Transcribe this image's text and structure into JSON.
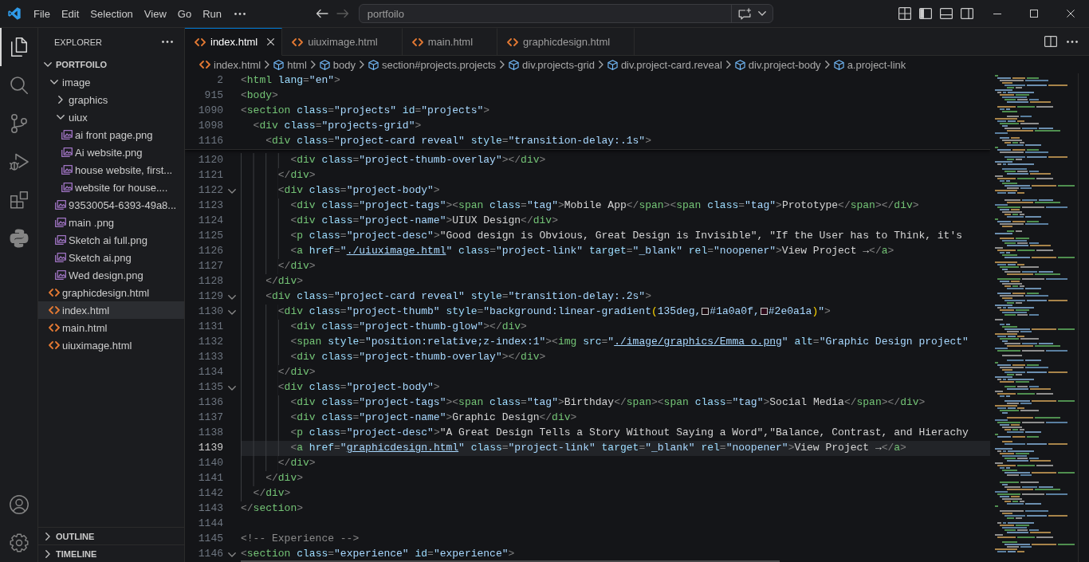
{
  "title_bar": {
    "menu": [
      "File",
      "Edit",
      "Selection",
      "View",
      "Go",
      "Run"
    ],
    "nav_buttons": [
      {
        "kind": "back",
        "disabled": false
      },
      {
        "kind": "forward",
        "disabled": true
      }
    ],
    "command_center": {
      "label": "portfoilo"
    },
    "layout_toggles": [
      {
        "kind": "primary_sidebar",
        "on": true
      },
      {
        "kind": "panel",
        "on": false
      },
      {
        "kind": "secondary_sidebar",
        "on": false
      }
    ]
  },
  "activity_bar": {
    "items": [
      {
        "kind": "explorer",
        "selected": true
      },
      {
        "kind": "search",
        "selected": false
      },
      {
        "kind": "source_control",
        "selected": false
      },
      {
        "kind": "run_debug",
        "selected": false
      },
      {
        "kind": "extensions",
        "selected": false
      },
      {
        "kind": "python",
        "selected": false
      }
    ],
    "bottom_items": [
      {
        "kind": "accounts"
      },
      {
        "kind": "settings"
      }
    ]
  },
  "explorer": {
    "title": "EXPLORER",
    "folder": {
      "label": "PORTFOILO",
      "expanded": true
    },
    "tree": [
      {
        "label": "image",
        "kind": "folder",
        "expanded": true,
        "selected": false,
        "children": [
          {
            "label": "graphics",
            "kind": "folder",
            "expanded": false,
            "selected": false
          },
          {
            "label": "uiux",
            "kind": "folder",
            "expanded": true,
            "selected": false,
            "children": [
              {
                "label": "ai front page.png",
                "kind": "image",
                "selected": false
              },
              {
                "label": "Ai website.png",
                "kind": "image",
                "selected": false
              },
              {
                "label": "house website, first...",
                "kind": "image",
                "selected": false
              },
              {
                "label": "website for house....",
                "kind": "image",
                "selected": false
              }
            ]
          },
          {
            "label": "93530054-6393-49a8...",
            "kind": "image",
            "selected": false
          },
          {
            "label": "main .png",
            "kind": "image",
            "selected": false
          },
          {
            "label": "Sketch ai full.png",
            "kind": "image",
            "selected": false
          },
          {
            "label": "Sketch ai.png",
            "kind": "image",
            "selected": false
          },
          {
            "label": "Wed design.png",
            "kind": "image",
            "selected": false
          }
        ]
      },
      {
        "label": "graphicdesign.html",
        "kind": "html",
        "selected": false
      },
      {
        "label": "index.html",
        "kind": "html",
        "selected": true
      },
      {
        "label": "main.html",
        "kind": "html",
        "selected": false
      },
      {
        "label": "uiuximage.html",
        "kind": "html",
        "selected": false
      }
    ],
    "sections": [
      {
        "label": "OUTLINE",
        "expanded": false
      },
      {
        "label": "TIMELINE",
        "expanded": false
      }
    ]
  },
  "tabs": [
    {
      "label": "index.html",
      "selected": true
    },
    {
      "label": "uiuximage.html",
      "selected": false
    },
    {
      "label": "main.html",
      "selected": false
    },
    {
      "label": "graphicdesign.html",
      "selected": false
    }
  ],
  "breadcrumbs": [
    {
      "label": "index.html",
      "kind": "file"
    },
    {
      "label": "html",
      "kind": "element"
    },
    {
      "label": "body",
      "kind": "element"
    },
    {
      "label": "section#projects.projects",
      "kind": "element"
    },
    {
      "label": "div.projects-grid",
      "kind": "element"
    },
    {
      "label": "div.project-card.reveal",
      "kind": "element"
    },
    {
      "label": "div.project-body",
      "kind": "element"
    },
    {
      "label": "a.project-link",
      "kind": "element"
    }
  ],
  "editor": {
    "sticky_lines": [
      {
        "number": "2",
        "tokens": [
          {
            "kind": "punct",
            "text": "<"
          },
          {
            "kind": "tag",
            "text": "html"
          },
          {
            "kind": "attr",
            "text": " lang"
          },
          {
            "kind": "punct",
            "text": "="
          },
          {
            "kind": "string",
            "text": "\"en\""
          },
          {
            "kind": "punct",
            "text": ">"
          }
        ]
      },
      {
        "number": "915",
        "tokens": [
          {
            "kind": "punct",
            "text": "<"
          },
          {
            "kind": "tag",
            "text": "body"
          },
          {
            "kind": "punct",
            "text": ">"
          }
        ]
      },
      {
        "number": "1090",
        "tokens": [
          {
            "kind": "punct",
            "text": "<"
          },
          {
            "kind": "tag",
            "text": "section"
          },
          {
            "kind": "attr",
            "text": " class"
          },
          {
            "kind": "punct",
            "text": "="
          },
          {
            "kind": "string",
            "text": "\"projects\""
          },
          {
            "kind": "attr",
            "text": " id"
          },
          {
            "kind": "punct",
            "text": "="
          },
          {
            "kind": "string",
            "text": "\"projects\""
          },
          {
            "kind": "punct",
            "text": ">"
          }
        ]
      },
      {
        "number": "1098",
        "tokens": [
          {
            "kind": "punct",
            "text": "  <"
          },
          {
            "kind": "tag",
            "text": "div"
          },
          {
            "kind": "attr",
            "text": " class"
          },
          {
            "kind": "punct",
            "text": "="
          },
          {
            "kind": "string",
            "text": "\"projects-grid\""
          },
          {
            "kind": "punct",
            "text": ">"
          }
        ]
      },
      {
        "number": "1116",
        "tokens": [
          {
            "kind": "punct",
            "text": "    <"
          },
          {
            "kind": "tag",
            "text": "div"
          },
          {
            "kind": "attr",
            "text": " class"
          },
          {
            "kind": "punct",
            "text": "="
          },
          {
            "kind": "string",
            "text": "\"project-card reveal\""
          },
          {
            "kind": "attr",
            "text": " style"
          },
          {
            "kind": "punct",
            "text": "="
          },
          {
            "kind": "string",
            "text": "\"transition-delay:.1s\""
          },
          {
            "kind": "punct",
            "text": ">"
          }
        ]
      }
    ],
    "lines": [
      {
        "number": "1120",
        "fold_marker": false,
        "current": false,
        "tokens": [
          {
            "kind": "punct",
            "text": "        <"
          },
          {
            "kind": "tag",
            "text": "div"
          },
          {
            "kind": "attr",
            "text": " class"
          },
          {
            "kind": "punct",
            "text": "="
          },
          {
            "kind": "string",
            "text": "\"project-thumb-overlay\""
          },
          {
            "kind": "punct",
            "text": "></"
          },
          {
            "kind": "tag",
            "text": "div"
          },
          {
            "kind": "punct",
            "text": ">"
          }
        ]
      },
      {
        "number": "1121",
        "fold_marker": false,
        "current": false,
        "tokens": [
          {
            "kind": "punct",
            "text": "      </"
          },
          {
            "kind": "tag",
            "text": "div"
          },
          {
            "kind": "punct",
            "text": ">"
          }
        ]
      },
      {
        "number": "1122",
        "fold_marker": true,
        "current": false,
        "tokens": [
          {
            "kind": "punct",
            "text": "      <"
          },
          {
            "kind": "tag",
            "text": "div"
          },
          {
            "kind": "attr",
            "text": " class"
          },
          {
            "kind": "punct",
            "text": "="
          },
          {
            "kind": "string",
            "text": "\"project-body\""
          },
          {
            "kind": "punct",
            "text": ">"
          }
        ]
      },
      {
        "number": "1123",
        "fold_marker": false,
        "current": false,
        "tokens": [
          {
            "kind": "punct",
            "text": "        <"
          },
          {
            "kind": "tag",
            "text": "div"
          },
          {
            "kind": "attr",
            "text": " class"
          },
          {
            "kind": "punct",
            "text": "="
          },
          {
            "kind": "string",
            "text": "\"project-tags\""
          },
          {
            "kind": "punct",
            "text": "><"
          },
          {
            "kind": "tag",
            "text": "span"
          },
          {
            "kind": "attr",
            "text": " class"
          },
          {
            "kind": "punct",
            "text": "="
          },
          {
            "kind": "string",
            "text": "\"tag\""
          },
          {
            "kind": "punct",
            "text": ">"
          },
          {
            "kind": "text",
            "text": "Mobile App"
          },
          {
            "kind": "punct",
            "text": "</"
          },
          {
            "kind": "tag",
            "text": "span"
          },
          {
            "kind": "punct",
            "text": "><"
          },
          {
            "kind": "tag",
            "text": "span"
          },
          {
            "kind": "attr",
            "text": " class"
          },
          {
            "kind": "punct",
            "text": "="
          },
          {
            "kind": "string",
            "text": "\"tag\""
          },
          {
            "kind": "punct",
            "text": ">"
          },
          {
            "kind": "text",
            "text": "Prototype"
          },
          {
            "kind": "punct",
            "text": "</"
          },
          {
            "kind": "tag",
            "text": "span"
          },
          {
            "kind": "punct",
            "text": "></"
          },
          {
            "kind": "tag",
            "text": "div"
          },
          {
            "kind": "punct",
            "text": ">"
          }
        ]
      },
      {
        "number": "1124",
        "fold_marker": false,
        "current": false,
        "tokens": [
          {
            "kind": "punct",
            "text": "        <"
          },
          {
            "kind": "tag",
            "text": "div"
          },
          {
            "kind": "attr",
            "text": " class"
          },
          {
            "kind": "punct",
            "text": "="
          },
          {
            "kind": "string",
            "text": "\"project-name\""
          },
          {
            "kind": "punct",
            "text": ">"
          },
          {
            "kind": "text",
            "text": "UIUX Design"
          },
          {
            "kind": "punct",
            "text": "</"
          },
          {
            "kind": "tag",
            "text": "div"
          },
          {
            "kind": "punct",
            "text": ">"
          }
        ]
      },
      {
        "number": "1125",
        "fold_marker": false,
        "current": false,
        "tokens": [
          {
            "kind": "punct",
            "text": "        <"
          },
          {
            "kind": "tag",
            "text": "p"
          },
          {
            "kind": "attr",
            "text": " class"
          },
          {
            "kind": "punct",
            "text": "="
          },
          {
            "kind": "string",
            "text": "\"project-desc\""
          },
          {
            "kind": "punct",
            "text": ">"
          },
          {
            "kind": "text",
            "text": "\"Good design is Obvious, Great Design is Invisible\", \"If the User has to Think, it's"
          }
        ]
      },
      {
        "number": "1126",
        "fold_marker": false,
        "current": false,
        "tokens": [
          {
            "kind": "punct",
            "text": "        <"
          },
          {
            "kind": "tag",
            "text": "a"
          },
          {
            "kind": "attr",
            "text": " href"
          },
          {
            "kind": "punct",
            "text": "="
          },
          {
            "kind": "string",
            "text": "\""
          },
          {
            "kind": "link",
            "text": "./uiuximage.html"
          },
          {
            "kind": "string",
            "text": "\""
          },
          {
            "kind": "attr",
            "text": " class"
          },
          {
            "kind": "punct",
            "text": "="
          },
          {
            "kind": "string",
            "text": "\"project-link\""
          },
          {
            "kind": "attr",
            "text": " target"
          },
          {
            "kind": "punct",
            "text": "="
          },
          {
            "kind": "string",
            "text": "\"_blank\""
          },
          {
            "kind": "attr",
            "text": " rel"
          },
          {
            "kind": "punct",
            "text": "="
          },
          {
            "kind": "string",
            "text": "\"noopener\""
          },
          {
            "kind": "punct",
            "text": ">"
          },
          {
            "kind": "text",
            "text": "View Project →"
          },
          {
            "kind": "punct",
            "text": "</"
          },
          {
            "kind": "tag",
            "text": "a"
          },
          {
            "kind": "punct",
            "text": ">"
          }
        ]
      },
      {
        "number": "1127",
        "fold_marker": false,
        "current": false,
        "tokens": [
          {
            "kind": "punct",
            "text": "      </"
          },
          {
            "kind": "tag",
            "text": "div"
          },
          {
            "kind": "punct",
            "text": ">"
          }
        ]
      },
      {
        "number": "1128",
        "fold_marker": false,
        "current": false,
        "tokens": [
          {
            "kind": "punct",
            "text": "    </"
          },
          {
            "kind": "tag",
            "text": "div"
          },
          {
            "kind": "punct",
            "text": ">"
          }
        ]
      },
      {
        "number": "1129",
        "fold_marker": true,
        "current": false,
        "tokens": [
          {
            "kind": "punct",
            "text": "    <"
          },
          {
            "kind": "tag",
            "text": "div"
          },
          {
            "kind": "attr",
            "text": " class"
          },
          {
            "kind": "punct",
            "text": "="
          },
          {
            "kind": "string",
            "text": "\"project-card reveal\""
          },
          {
            "kind": "attr",
            "text": " style"
          },
          {
            "kind": "punct",
            "text": "="
          },
          {
            "kind": "string",
            "text": "\"transition-delay:.2s\""
          },
          {
            "kind": "punct",
            "text": ">"
          }
        ]
      },
      {
        "number": "1130",
        "fold_marker": true,
        "current": false,
        "tokens": [
          {
            "kind": "punct",
            "text": "      <"
          },
          {
            "kind": "tag",
            "text": "div"
          },
          {
            "kind": "attr",
            "text": " class"
          },
          {
            "kind": "punct",
            "text": "="
          },
          {
            "kind": "string",
            "text": "\"project-thumb\""
          },
          {
            "kind": "attr",
            "text": " style"
          },
          {
            "kind": "punct",
            "text": "="
          },
          {
            "kind": "string",
            "text": "\"background:linear-gradient"
          },
          {
            "kind": "bracket",
            "text": "("
          },
          {
            "kind": "string",
            "text": "135deg,"
          },
          {
            "kind": "swatch",
            "color": "#1a0a0f"
          },
          {
            "kind": "string",
            "text": "#1a0a0f,"
          },
          {
            "kind": "swatch",
            "color": "#2e0a1a"
          },
          {
            "kind": "string",
            "text": "#2e0a1a"
          },
          {
            "kind": "bracket",
            "text": ")"
          },
          {
            "kind": "string",
            "text": "\""
          },
          {
            "kind": "punct",
            "text": ">"
          }
        ]
      },
      {
        "number": "1131",
        "fold_marker": false,
        "current": false,
        "tokens": [
          {
            "kind": "punct",
            "text": "        <"
          },
          {
            "kind": "tag",
            "text": "div"
          },
          {
            "kind": "attr",
            "text": " class"
          },
          {
            "kind": "punct",
            "text": "="
          },
          {
            "kind": "string",
            "text": "\"project-thumb-glow\""
          },
          {
            "kind": "punct",
            "text": "></"
          },
          {
            "kind": "tag",
            "text": "div"
          },
          {
            "kind": "punct",
            "text": ">"
          }
        ]
      },
      {
        "number": "1132",
        "fold_marker": false,
        "current": false,
        "tokens": [
          {
            "kind": "punct",
            "text": "        <"
          },
          {
            "kind": "tag",
            "text": "span"
          },
          {
            "kind": "attr",
            "text": " style"
          },
          {
            "kind": "punct",
            "text": "="
          },
          {
            "kind": "string",
            "text": "\"position:relative;z-index:1\""
          },
          {
            "kind": "punct",
            "text": "><"
          },
          {
            "kind": "tag",
            "text": "img"
          },
          {
            "kind": "attr",
            "text": " src"
          },
          {
            "kind": "punct",
            "text": "="
          },
          {
            "kind": "string",
            "text": "\""
          },
          {
            "kind": "link",
            "text": "./image/graphics/Emma_o.png"
          },
          {
            "kind": "string",
            "text": "\""
          },
          {
            "kind": "attr",
            "text": " alt"
          },
          {
            "kind": "punct",
            "text": "="
          },
          {
            "kind": "string",
            "text": "\"Graphic Design project\""
          }
        ]
      },
      {
        "number": "1133",
        "fold_marker": false,
        "current": false,
        "tokens": [
          {
            "kind": "punct",
            "text": "        <"
          },
          {
            "kind": "tag",
            "text": "div"
          },
          {
            "kind": "attr",
            "text": " class"
          },
          {
            "kind": "punct",
            "text": "="
          },
          {
            "kind": "string",
            "text": "\"project-thumb-overlay\""
          },
          {
            "kind": "punct",
            "text": "></"
          },
          {
            "kind": "tag",
            "text": "div"
          },
          {
            "kind": "punct",
            "text": ">"
          }
        ]
      },
      {
        "number": "1134",
        "fold_marker": false,
        "current": false,
        "tokens": [
          {
            "kind": "punct",
            "text": "      </"
          },
          {
            "kind": "tag",
            "text": "div"
          },
          {
            "kind": "punct",
            "text": ">"
          }
        ]
      },
      {
        "number": "1135",
        "fold_marker": true,
        "current": false,
        "tokens": [
          {
            "kind": "punct",
            "text": "      <"
          },
          {
            "kind": "tag",
            "text": "div"
          },
          {
            "kind": "attr",
            "text": " class"
          },
          {
            "kind": "punct",
            "text": "="
          },
          {
            "kind": "string",
            "text": "\"project-body\""
          },
          {
            "kind": "punct",
            "text": ">"
          }
        ]
      },
      {
        "number": "1136",
        "fold_marker": false,
        "current": false,
        "tokens": [
          {
            "kind": "punct",
            "text": "        <"
          },
          {
            "kind": "tag",
            "text": "div"
          },
          {
            "kind": "attr",
            "text": " class"
          },
          {
            "kind": "punct",
            "text": "="
          },
          {
            "kind": "string",
            "text": "\"project-tags\""
          },
          {
            "kind": "punct",
            "text": "><"
          },
          {
            "kind": "tag",
            "text": "span"
          },
          {
            "kind": "attr",
            "text": " class"
          },
          {
            "kind": "punct",
            "text": "="
          },
          {
            "kind": "string",
            "text": "\"tag\""
          },
          {
            "kind": "punct",
            "text": ">"
          },
          {
            "kind": "text",
            "text": "Birthday"
          },
          {
            "kind": "punct",
            "text": "</"
          },
          {
            "kind": "tag",
            "text": "span"
          },
          {
            "kind": "punct",
            "text": "><"
          },
          {
            "kind": "tag",
            "text": "span"
          },
          {
            "kind": "attr",
            "text": " class"
          },
          {
            "kind": "punct",
            "text": "="
          },
          {
            "kind": "string",
            "text": "\"tag\""
          },
          {
            "kind": "punct",
            "text": ">"
          },
          {
            "kind": "text",
            "text": "Social Media"
          },
          {
            "kind": "punct",
            "text": "</"
          },
          {
            "kind": "tag",
            "text": "span"
          },
          {
            "kind": "punct",
            "text": "></"
          },
          {
            "kind": "tag",
            "text": "div"
          },
          {
            "kind": "punct",
            "text": ">"
          }
        ]
      },
      {
        "number": "1137",
        "fold_marker": false,
        "current": false,
        "tokens": [
          {
            "kind": "punct",
            "text": "        <"
          },
          {
            "kind": "tag",
            "text": "div"
          },
          {
            "kind": "attr",
            "text": " class"
          },
          {
            "kind": "punct",
            "text": "="
          },
          {
            "kind": "string",
            "text": "\"project-name\""
          },
          {
            "kind": "punct",
            "text": ">"
          },
          {
            "kind": "text",
            "text": "Graphic Design"
          },
          {
            "kind": "punct",
            "text": "</"
          },
          {
            "kind": "tag",
            "text": "div"
          },
          {
            "kind": "punct",
            "text": ">"
          }
        ]
      },
      {
        "number": "1138",
        "fold_marker": false,
        "current": false,
        "tokens": [
          {
            "kind": "punct",
            "text": "        <"
          },
          {
            "kind": "tag",
            "text": "p"
          },
          {
            "kind": "attr",
            "text": " class"
          },
          {
            "kind": "punct",
            "text": "="
          },
          {
            "kind": "string",
            "text": "\"project-desc\""
          },
          {
            "kind": "punct",
            "text": ">"
          },
          {
            "kind": "text",
            "text": "\"A Great Design Tells a Story Without Saying a Word\",\"Balance, Contrast, and Hierachy"
          }
        ]
      },
      {
        "number": "1139",
        "fold_marker": false,
        "current": true,
        "tokens": [
          {
            "kind": "punct",
            "text": "        <"
          },
          {
            "kind": "tag",
            "text": "a"
          },
          {
            "kind": "attr",
            "text": " href"
          },
          {
            "kind": "punct",
            "text": "="
          },
          {
            "kind": "string",
            "text": "\""
          },
          {
            "kind": "link",
            "text": "graphicdesign.html"
          },
          {
            "kind": "string",
            "text": "\""
          },
          {
            "kind": "attr",
            "text": " class"
          },
          {
            "kind": "punct",
            "text": "="
          },
          {
            "kind": "string",
            "text": "\"project-link\""
          },
          {
            "kind": "attr",
            "text": " target"
          },
          {
            "kind": "punct",
            "text": "="
          },
          {
            "kind": "string",
            "text": "\"_blank\""
          },
          {
            "kind": "attr",
            "text": " rel"
          },
          {
            "kind": "punct",
            "text": "="
          },
          {
            "kind": "string",
            "text": "\"noopener\""
          },
          {
            "kind": "punct",
            "text": ">"
          },
          {
            "kind": "text",
            "text": "View Project →"
          },
          {
            "kind": "punct",
            "text": "</"
          },
          {
            "kind": "tag",
            "text": "a"
          },
          {
            "kind": "punct",
            "text": ">"
          }
        ]
      },
      {
        "number": "1140",
        "fold_marker": false,
        "current": false,
        "tokens": [
          {
            "kind": "punct",
            "text": "      </"
          },
          {
            "kind": "tag",
            "text": "div"
          },
          {
            "kind": "punct",
            "text": ">"
          }
        ]
      },
      {
        "number": "1141",
        "fold_marker": false,
        "current": false,
        "tokens": [
          {
            "kind": "punct",
            "text": "    </"
          },
          {
            "kind": "tag",
            "text": "div"
          },
          {
            "kind": "punct",
            "text": ">"
          }
        ]
      },
      {
        "number": "1142",
        "fold_marker": false,
        "current": false,
        "tokens": [
          {
            "kind": "punct",
            "text": "  </"
          },
          {
            "kind": "tag",
            "text": "div"
          },
          {
            "kind": "punct",
            "text": ">"
          }
        ]
      },
      {
        "number": "1143",
        "fold_marker": false,
        "current": false,
        "tokens": [
          {
            "kind": "punct",
            "text": "</"
          },
          {
            "kind": "tag",
            "text": "section"
          },
          {
            "kind": "punct",
            "text": ">"
          }
        ]
      },
      {
        "number": "1144",
        "fold_marker": false,
        "current": false
      },
      {
        "number": "1145",
        "fold_marker": false,
        "current": false,
        "tokens": [
          {
            "kind": "comment",
            "text": "<!-- Experience -->"
          }
        ]
      },
      {
        "number": "1146",
        "fold_marker": true,
        "current": false,
        "tokens": [
          {
            "kind": "punct",
            "text": "<"
          },
          {
            "kind": "tag",
            "text": "section"
          },
          {
            "kind": "attr",
            "text": " class"
          },
          {
            "kind": "punct",
            "text": "="
          },
          {
            "kind": "string",
            "text": "\"experience\""
          },
          {
            "kind": "attr",
            "text": " id"
          },
          {
            "kind": "punct",
            "text": "="
          },
          {
            "kind": "string",
            "text": "\"experience\""
          },
          {
            "kind": "punct",
            "text": ">"
          }
        ]
      }
    ]
  }
}
